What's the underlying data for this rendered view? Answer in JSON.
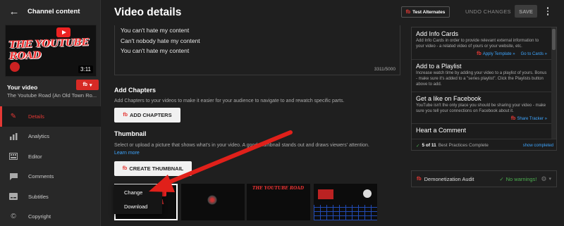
{
  "sidebar": {
    "title": "Channel content",
    "video_duration": "3:11",
    "thumb_text": "THE YOUTUBE ROAD",
    "your_video_label": "Your video",
    "video_name": "The Youtube Road (An Old Town Ro...",
    "fb_button_label": "fb",
    "nav": [
      {
        "label": "Details",
        "icon": "pencil-icon",
        "active": true
      },
      {
        "label": "Analytics",
        "icon": "analytics-icon",
        "active": false
      },
      {
        "label": "Editor",
        "icon": "editor-icon",
        "active": false
      },
      {
        "label": "Comments",
        "icon": "comments-icon",
        "active": false
      },
      {
        "label": "Subtitles",
        "icon": "subtitles-icon",
        "active": false
      },
      {
        "label": "Copyright",
        "icon": "copyright-icon",
        "active": false
      }
    ]
  },
  "header": {
    "title": "Video details",
    "test_alternates": "Test Alternates",
    "undo": "UNDO CHANGES",
    "save": "SAVE"
  },
  "description": {
    "lines": [
      "You can't hate my content",
      "Can't nobody hate my content",
      "You can't hate my content"
    ],
    "count": "3311/5000"
  },
  "chapters": {
    "title": "Add Chapters",
    "text": "Add Chapters to your videos to make it easier for your audience to navigate to and rewatch specific parts.",
    "button": "ADD CHAPTERS"
  },
  "thumbnail": {
    "title": "Thumbnail",
    "text": "Select or upload a picture that shows what's in your video. A good thumbnail stands out and draws viewers' attention.",
    "learn_more": "Learn more",
    "button": "CREATE THUMBNAIL",
    "menu": [
      "Change",
      "Download"
    ]
  },
  "right_panel": {
    "cards": [
      {
        "title": "Add Info Cards",
        "text": "Add Info Cards in order to provide relevant external information to your video - a related video of yours or your website, etc.",
        "links": [
          "Apply Template »",
          "Go to Cards »"
        ]
      },
      {
        "title": "Add to a Playlist",
        "text": "Increase watch time by adding your video to a playlist of yours. Bonus - make sure it's added to a \"series playlist\". Click the Playlists button above to add.",
        "links": []
      },
      {
        "title": "Get a like on Facebook",
        "text": "YouTube isn't the only place you should be sharing your video - make sure you tell your connections on Facebook about it.",
        "links": [
          "Share Tracker »"
        ]
      },
      {
        "title": "Heart a Comment",
        "text": "",
        "links": []
      }
    ],
    "complete_count": "5 of 11",
    "complete_text": "Best Practices Complete",
    "show_completed": "show completed"
  },
  "demonetization": {
    "label": "Demonetization Audit",
    "status": "No warnings!"
  },
  "colors": {
    "accent": "#e53935",
    "link": "#3ea6ff",
    "success": "#4caf50"
  }
}
